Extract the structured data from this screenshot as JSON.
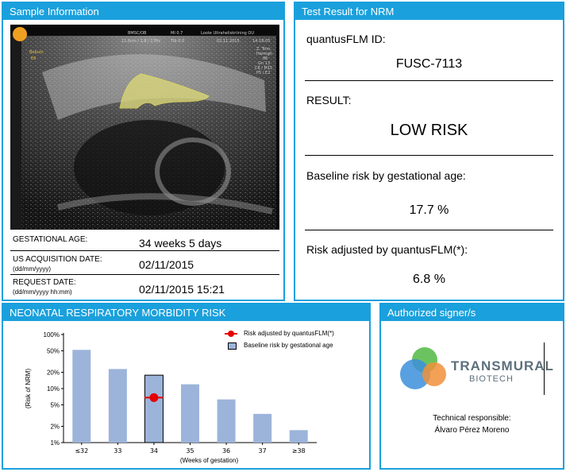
{
  "sample": {
    "title": "Sample Information",
    "image": {
      "header_lines": [
        "BMSC/OB",
        "MI 0.7",
        "Loote Ultraheliskriining OU",
        "11.6cm / 1.8 / 17Hz",
        "TIb 0.0",
        "02.11.2015",
        "14:18:05"
      ],
      "side_lines": [
        "Z. Trim.",
        "Harmgh",
        "86",
        "Gn 13",
        "C6 / M15",
        "P5 / E2"
      ],
      "left_marks": [
        "Bebum",
        "E6"
      ]
    },
    "gestational_age_label": "GESTATIONAL AGE:",
    "gestational_age_value": "34 weeks 5 days",
    "us_acq_label": "US ACQUISITION DATE:",
    "us_acq_format": "(dd/mm/yyyy)",
    "us_acq_value": "02/11/2015",
    "request_label": "REQUEST DATE:",
    "request_format": "(dd/mm/yyyy hh:mm)",
    "request_value": "02/11/2015 15:21"
  },
  "result": {
    "title": "Test Result for NRM",
    "id_label": "quantusFLM ID:",
    "id_value": "FUSC-7113",
    "result_label": "RESULT:",
    "result_value": "LOW RISK",
    "baseline_label": "Baseline risk by gestational age:",
    "baseline_value": "17.7 %",
    "adjusted_label": "Risk adjusted by quantusFLM(*):",
    "adjusted_value": "6.8 %"
  },
  "risk": {
    "title": "NEONATAL RESPIRATORY MORBIDITY RISK",
    "legend_adjusted": "Risk adjusted by quantusFLM(*)",
    "legend_baseline": "Baseline risk by gestational age"
  },
  "chart_data": {
    "type": "bar",
    "title": "",
    "xlabel": "(Weeks of gestation)",
    "ylabel": "(Risk of NRM)",
    "y_scale": "log",
    "ylim": [
      1,
      100
    ],
    "y_ticks": [
      1,
      2,
      5,
      10,
      20,
      50,
      100
    ],
    "y_tick_labels": [
      "1%",
      "2%",
      "5%",
      "10%",
      "20%",
      "50%",
      "100%"
    ],
    "categories": [
      "≤32",
      "33",
      "34",
      "35",
      "36",
      "37",
      "≥38"
    ],
    "series": [
      {
        "name": "Baseline risk by gestational age",
        "values": [
          52,
          23,
          17.7,
          12,
          6.3,
          3.4,
          1.7
        ]
      },
      {
        "name": "Risk adjusted by quantusFLM(*)",
        "values": [
          null,
          null,
          6.8,
          null,
          null,
          null,
          null
        ]
      }
    ],
    "highlight_category": "34",
    "colors": {
      "bar": "#9cb4da",
      "adjusted": "#e50000"
    },
    "legend": "top-right",
    "grid": false
  },
  "signer": {
    "title": "Authorized signer/s",
    "logo_line1": "TRANSMURAL",
    "logo_line2": "BIOTECH",
    "role": "Technical responsible:",
    "name": "Álvaro Pérez Moreno"
  },
  "colors": {
    "accent": "#1aa0dc"
  }
}
